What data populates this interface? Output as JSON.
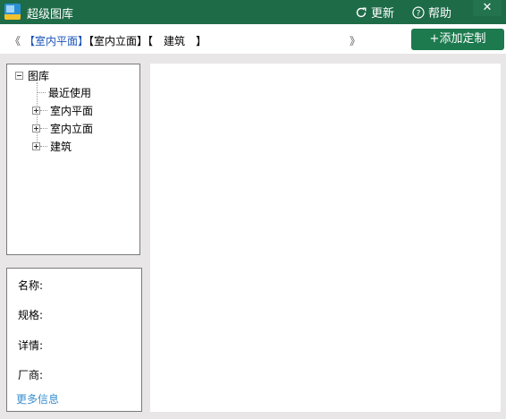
{
  "window": {
    "title": "超级图库",
    "refresh_label": "更新",
    "help_label": "帮助",
    "close_glyph": "✕"
  },
  "navbar": {
    "prev_glyph": "《",
    "next_glyph": "》",
    "crumbs": [
      {
        "label": "【室内平面】"
      },
      {
        "label": "【室内立面】"
      },
      {
        "label": "【　建筑　】"
      }
    ],
    "add_button": "+添加定制"
  },
  "tree": {
    "root": "图库",
    "recent": "最近使用",
    "categories": [
      {
        "label": "室内平面"
      },
      {
        "label": "室内立面"
      },
      {
        "label": "建筑"
      }
    ]
  },
  "info": {
    "name_label": "名称:",
    "spec_label": "规格:",
    "detail_label": "详情:",
    "vendor_label": "厂商:",
    "more_link": "更多信息"
  },
  "colors": {
    "titlebar": "#1e6b48",
    "accent_button": "#1d7a4e",
    "active_crumb": "#1a54b8",
    "link": "#3a8fd0"
  }
}
